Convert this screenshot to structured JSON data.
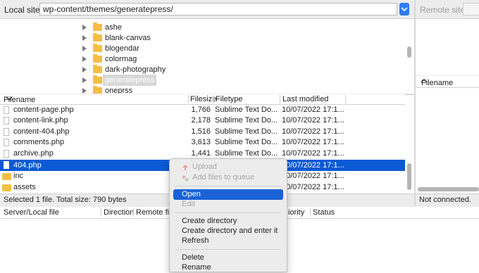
{
  "local_site": {
    "label": "Local site:",
    "path": "wp-content/themes/generatepress/"
  },
  "remote_site": {
    "label": "Remote site:"
  },
  "tree": {
    "items": [
      {
        "label": "ashe"
      },
      {
        "label": "blank-canvas"
      },
      {
        "label": "blogendar"
      },
      {
        "label": "colormag"
      },
      {
        "label": "dark-photography"
      },
      {
        "label": "generatepress",
        "selected": true
      },
      {
        "label": "oneprss"
      }
    ]
  },
  "file_list": {
    "headers": {
      "filename": "Filename",
      "filesize": "Filesize",
      "filetype": "Filetype",
      "last_modified": "Last modified"
    },
    "rows": [
      {
        "name": "content-page.php",
        "size": "1,766",
        "type": "Sublime Text Do...",
        "modified": "10/07/2022 17:1...",
        "kind": "file"
      },
      {
        "name": "content-link.php",
        "size": "2,178",
        "type": "Sublime Text Do...",
        "modified": "10/07/2022 17:1...",
        "kind": "file"
      },
      {
        "name": "content-404.php",
        "size": "1,516",
        "type": "Sublime Text Do...",
        "modified": "10/07/2022 17:1...",
        "kind": "file"
      },
      {
        "name": "comments.php",
        "size": "3,613",
        "type": "Sublime Text Do...",
        "modified": "10/07/2022 17:1...",
        "kind": "file"
      },
      {
        "name": "archive.php",
        "size": "1,441",
        "type": "Sublime Text Do...",
        "modified": "10/07/2022 17:1...",
        "kind": "file"
      },
      {
        "name": "404.php",
        "size": "",
        "type": "",
        "modified": "10/07/2022 17:1...",
        "kind": "file",
        "selected": true
      },
      {
        "name": "inc",
        "size": "",
        "type": "",
        "modified": "10/07/2022 17:1...",
        "kind": "folder"
      },
      {
        "name": "assets",
        "size": "",
        "type": "",
        "modified": "10/07/2022 17:1...",
        "kind": "folder"
      }
    ],
    "status": "Selected 1 file. Total size: 790 bytes"
  },
  "remote_list": {
    "header": "Filename",
    "status": "Not connected."
  },
  "queue": {
    "headers": {
      "server_local": "Server/Local file",
      "direction": "Direction",
      "remote_file": "Remote file",
      "priority": "iority",
      "status": "Status"
    }
  },
  "context_menu": {
    "upload": "Upload",
    "add_to_queue": "Add files to queue",
    "open": "Open",
    "edit": "Edit",
    "create_dir": "Create directory",
    "create_dir_enter": "Create directory and enter it",
    "refresh": "Refresh",
    "delete": "Delete",
    "rename": "Rename"
  },
  "colors": {
    "accent": "#0b5ad3",
    "menu_highlight": "#1a62d6",
    "folder": "#f3c044"
  }
}
